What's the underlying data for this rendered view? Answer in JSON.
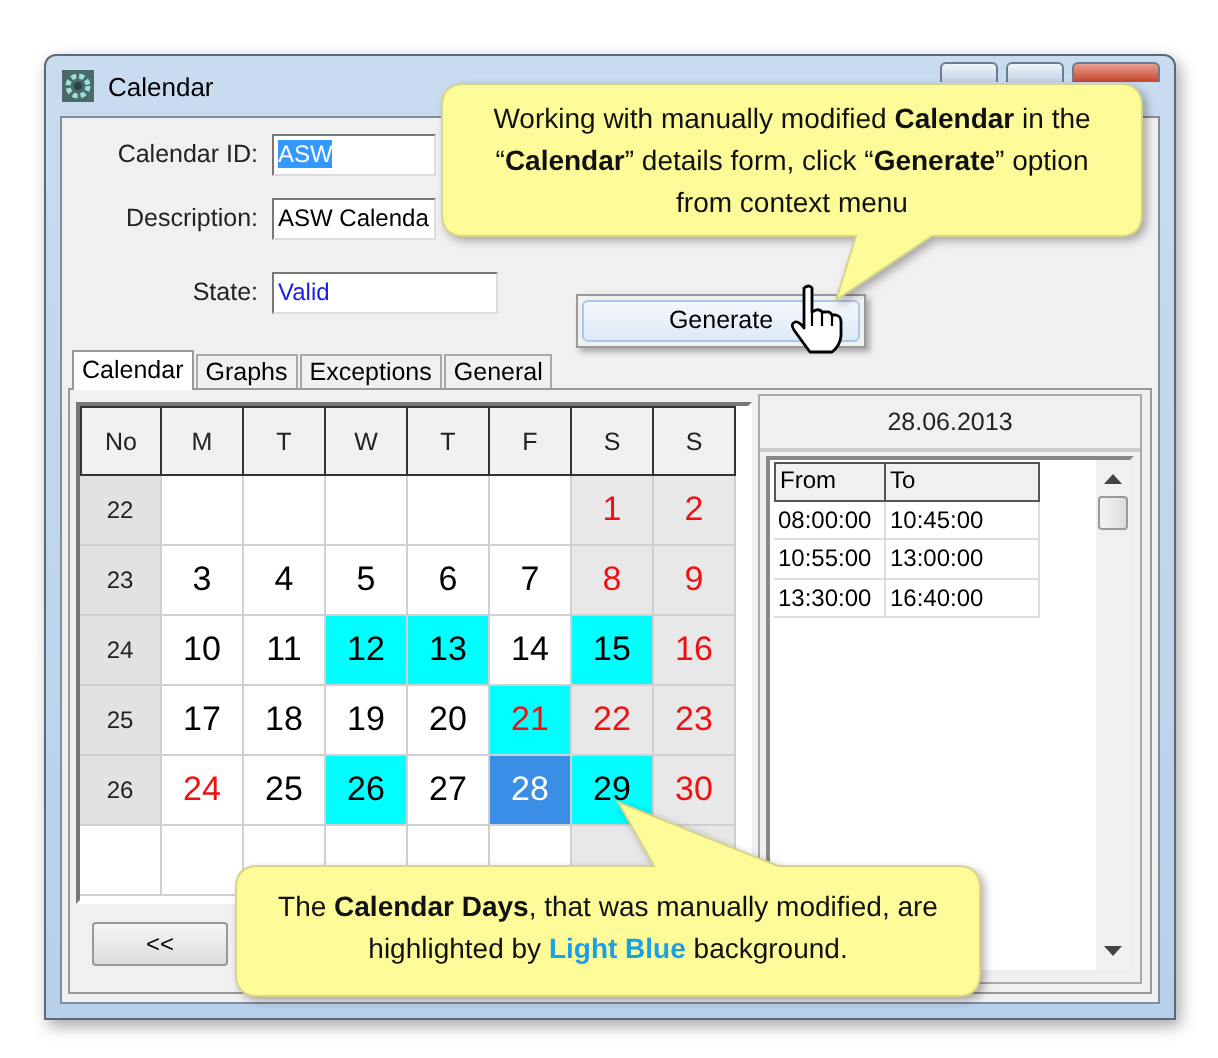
{
  "window": {
    "title": "Calendar"
  },
  "form": [
    {
      "label": "Calendar ID:",
      "value": "ASW",
      "kind": "text",
      "selected": true
    },
    {
      "label": "Description:",
      "value": "ASW Calenda",
      "kind": "text",
      "selected": false
    },
    {
      "label": "State:",
      "value": "Valid",
      "kind": "status",
      "selected": false
    }
  ],
  "tabs": [
    {
      "label": "Calendar",
      "selected": true
    },
    {
      "label": "Graphs",
      "selected": false
    },
    {
      "label": "Exceptions",
      "selected": false
    },
    {
      "label": "General",
      "selected": false
    }
  ],
  "calendar": {
    "columns": [
      {
        "label": "No",
        "weekend": false
      },
      {
        "label": "M",
        "weekend": false
      },
      {
        "label": "T",
        "weekend": false
      },
      {
        "label": "W",
        "weekend": false
      },
      {
        "label": "T",
        "weekend": false
      },
      {
        "label": "F",
        "weekend": false
      },
      {
        "label": "S",
        "weekend": true
      },
      {
        "label": "S",
        "weekend": true
      }
    ],
    "weeks": [
      {
        "number": "22",
        "days": [
          {
            "kind": "blank"
          },
          {
            "kind": "blank"
          },
          {
            "kind": "blank"
          },
          {
            "kind": "blank"
          },
          {
            "kind": "blank"
          },
          {
            "day": "1",
            "red": true,
            "modified": false,
            "selected": false
          },
          {
            "day": "2",
            "red": true,
            "modified": false,
            "selected": false
          }
        ]
      },
      {
        "number": "23",
        "days": [
          {
            "day": "3",
            "red": false,
            "modified": false,
            "selected": false
          },
          {
            "day": "4",
            "red": false,
            "modified": false,
            "selected": false
          },
          {
            "day": "5",
            "red": false,
            "modified": false,
            "selected": false
          },
          {
            "day": "6",
            "red": false,
            "modified": false,
            "selected": false
          },
          {
            "day": "7",
            "red": false,
            "modified": false,
            "selected": false
          },
          {
            "day": "8",
            "red": true,
            "modified": false,
            "selected": false
          },
          {
            "day": "9",
            "red": true,
            "modified": false,
            "selected": false
          }
        ]
      },
      {
        "number": "24",
        "days": [
          {
            "day": "10",
            "red": false,
            "modified": false,
            "selected": false
          },
          {
            "day": "11",
            "red": false,
            "modified": false,
            "selected": false
          },
          {
            "day": "12",
            "red": false,
            "modified": true,
            "selected": false
          },
          {
            "day": "13",
            "red": false,
            "modified": true,
            "selected": false
          },
          {
            "day": "14",
            "red": false,
            "modified": false,
            "selected": false
          },
          {
            "day": "15",
            "red": false,
            "modified": true,
            "selected": false
          },
          {
            "day": "16",
            "red": true,
            "modified": false,
            "selected": false
          }
        ]
      },
      {
        "number": "25",
        "days": [
          {
            "day": "17",
            "red": false,
            "modified": false,
            "selected": false
          },
          {
            "day": "18",
            "red": false,
            "modified": false,
            "selected": false
          },
          {
            "day": "19",
            "red": false,
            "modified": false,
            "selected": false
          },
          {
            "day": "20",
            "red": false,
            "modified": false,
            "selected": false
          },
          {
            "day": "21",
            "red": true,
            "modified": true,
            "selected": false
          },
          {
            "day": "22",
            "red": true,
            "modified": false,
            "selected": false
          },
          {
            "day": "23",
            "red": true,
            "modified": false,
            "selected": false
          }
        ]
      },
      {
        "number": "26",
        "days": [
          {
            "day": "24",
            "red": true,
            "modified": false,
            "selected": false
          },
          {
            "day": "25",
            "red": false,
            "modified": false,
            "selected": false
          },
          {
            "day": "26",
            "red": false,
            "modified": true,
            "selected": false
          },
          {
            "day": "27",
            "red": false,
            "modified": false,
            "selected": false
          },
          {
            "day": "28",
            "red": false,
            "modified": false,
            "selected": true
          },
          {
            "day": "29",
            "red": false,
            "modified": true,
            "selected": false
          },
          {
            "day": "30",
            "red": true,
            "modified": false,
            "selected": false
          }
        ]
      }
    ],
    "nav_button": "<<"
  },
  "day_panel": {
    "date": "28.06.2013",
    "columns": [
      "From",
      "To"
    ],
    "rows": [
      [
        "08:00:00",
        "10:45:00"
      ],
      [
        "10:55:00",
        "13:00:00"
      ],
      [
        "13:30:00",
        "16:40:00"
      ]
    ]
  },
  "context_menu": {
    "items": [
      {
        "label": "Generate",
        "selected": true
      }
    ]
  },
  "callouts": [
    {
      "text": "Working with manually modified **Calendar** in the “**Calendar**” details form, click “**Generate**” option from context menu"
    },
    {
      "text": "The **Calendar Days**, that was manually modified, are highlighted by **Light Blue** background.",
      "kind": "accented"
    }
  ]
}
